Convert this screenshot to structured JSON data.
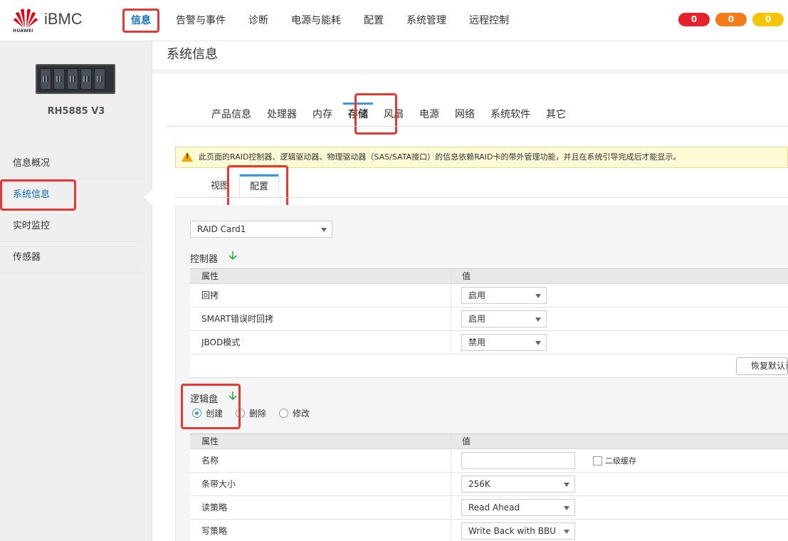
{
  "header": {
    "brand": "HUAWEI",
    "product": "iBMC",
    "nav": [
      "信息",
      "告警与事件",
      "诊断",
      "电源与能耗",
      "配置",
      "系统管理",
      "远程控制"
    ],
    "alarms": {
      "critical": "0",
      "major": "0",
      "minor": "0"
    }
  },
  "sidebar": {
    "server_name": "RH5885 V3",
    "items": [
      "信息概况",
      "系统信息",
      "实时监控",
      "传感器"
    ]
  },
  "page": {
    "title": "系统信息",
    "tabs": [
      "产品信息",
      "处理器",
      "内存",
      "存储",
      "风扇",
      "电源",
      "网络",
      "系统软件",
      "其它"
    ],
    "warning": "此页面的RAID控制器、逻辑驱动器、物理驱动器（SAS/SATA接口）的信息依赖RAID卡的带外管理功能，并且在系统引导完成后才能显示。",
    "subtabs": [
      "视图",
      "配置"
    ]
  },
  "raid": {
    "card_select": "RAID Card1",
    "controller": {
      "title": "控制器",
      "head": {
        "attr": "属性",
        "value": "值"
      },
      "rows": [
        {
          "attr": "回拷",
          "value": "启用"
        },
        {
          "attr": "SMART错误时回拷",
          "value": "启用"
        },
        {
          "attr": "JBOD模式",
          "value": "禁用"
        }
      ],
      "restore_button": "恢复默认设置"
    },
    "logical": {
      "title": "逻辑盘",
      "options": [
        "创建",
        "删除",
        "修改"
      ],
      "head": {
        "attr": "属性",
        "value": "值"
      },
      "name_label": "名称",
      "name_value": "",
      "secondary_cache": "二级缓存",
      "strip_label": "条带大小",
      "strip_value": "256K",
      "read_label": "读策略",
      "read_value": "Read Ahead",
      "write_label": "写策略",
      "write_value": "Write Back with BBU"
    }
  },
  "colors": {
    "accent": "#0a6fbd",
    "highlight": "#e53935",
    "tab_indicator": "#3a9ad9"
  }
}
